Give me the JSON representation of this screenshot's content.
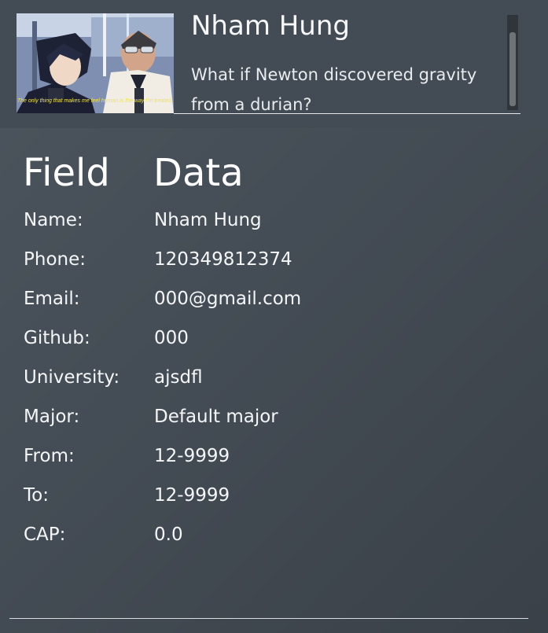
{
  "profile": {
    "name": "Nham Hung",
    "quote": "What if Newton discovered gravity from a durian?",
    "avatar_caption": "The only thing that makes me feel human is the way I'm treated."
  },
  "table": {
    "header_field": "Field",
    "header_data": "Data",
    "rows": [
      {
        "label": "Name:",
        "value": "Nham Hung"
      },
      {
        "label": "Phone:",
        "value": "120349812374"
      },
      {
        "label": "Email:",
        "value": "000@gmail.com"
      },
      {
        "label": "Github:",
        "value": "000"
      },
      {
        "label": "University:",
        "value": "ajsdfl"
      },
      {
        "label": "Major:",
        "value": "Default major"
      },
      {
        "label": "From:",
        "value": "12-9999"
      },
      {
        "label": "To:",
        "value": "12-9999"
      },
      {
        "label": "CAP:",
        "value": "0.0"
      }
    ]
  },
  "colors": {
    "background": "#444c55",
    "text": "#ffffff",
    "caption": "#f3e34a"
  }
}
